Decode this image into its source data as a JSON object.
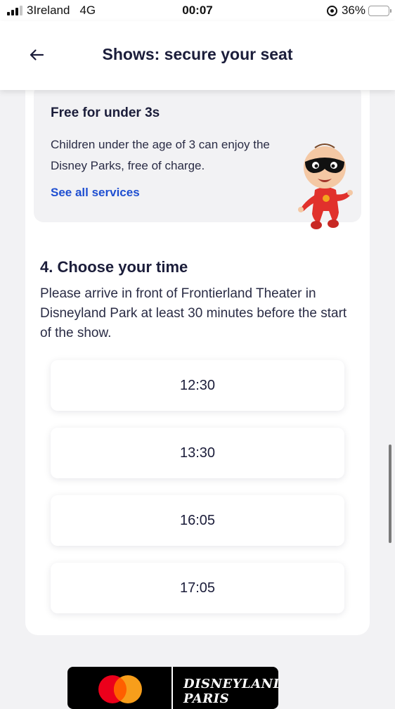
{
  "status_bar": {
    "carrier": "3Ireland",
    "network": "4G",
    "time": "00:07",
    "battery_percent": "36%",
    "battery_level": 0.36
  },
  "header": {
    "title": "Shows: secure your seat",
    "back_icon": "arrow-left-icon"
  },
  "info_box": {
    "title": "Free for under 3s",
    "text": "Children under the age of 3 can enjoy the Disney Parks, free of charge.",
    "link": "See all services"
  },
  "section": {
    "heading": "4. Choose your time",
    "description": "Please arrive in front of Frontierland Theater in Disneyland Park at least 30 minutes before the start of the show."
  },
  "time_slots": [
    "12:30",
    "13:30",
    "16:05",
    "17:05"
  ],
  "footer": {
    "brand_logo": "DISNEYLAND PARIS",
    "partner_logo": "mastercard-logo"
  },
  "colors": {
    "primary_text": "#1b1d3a",
    "link": "#1f4fd1",
    "background": "#f2f2f4"
  }
}
